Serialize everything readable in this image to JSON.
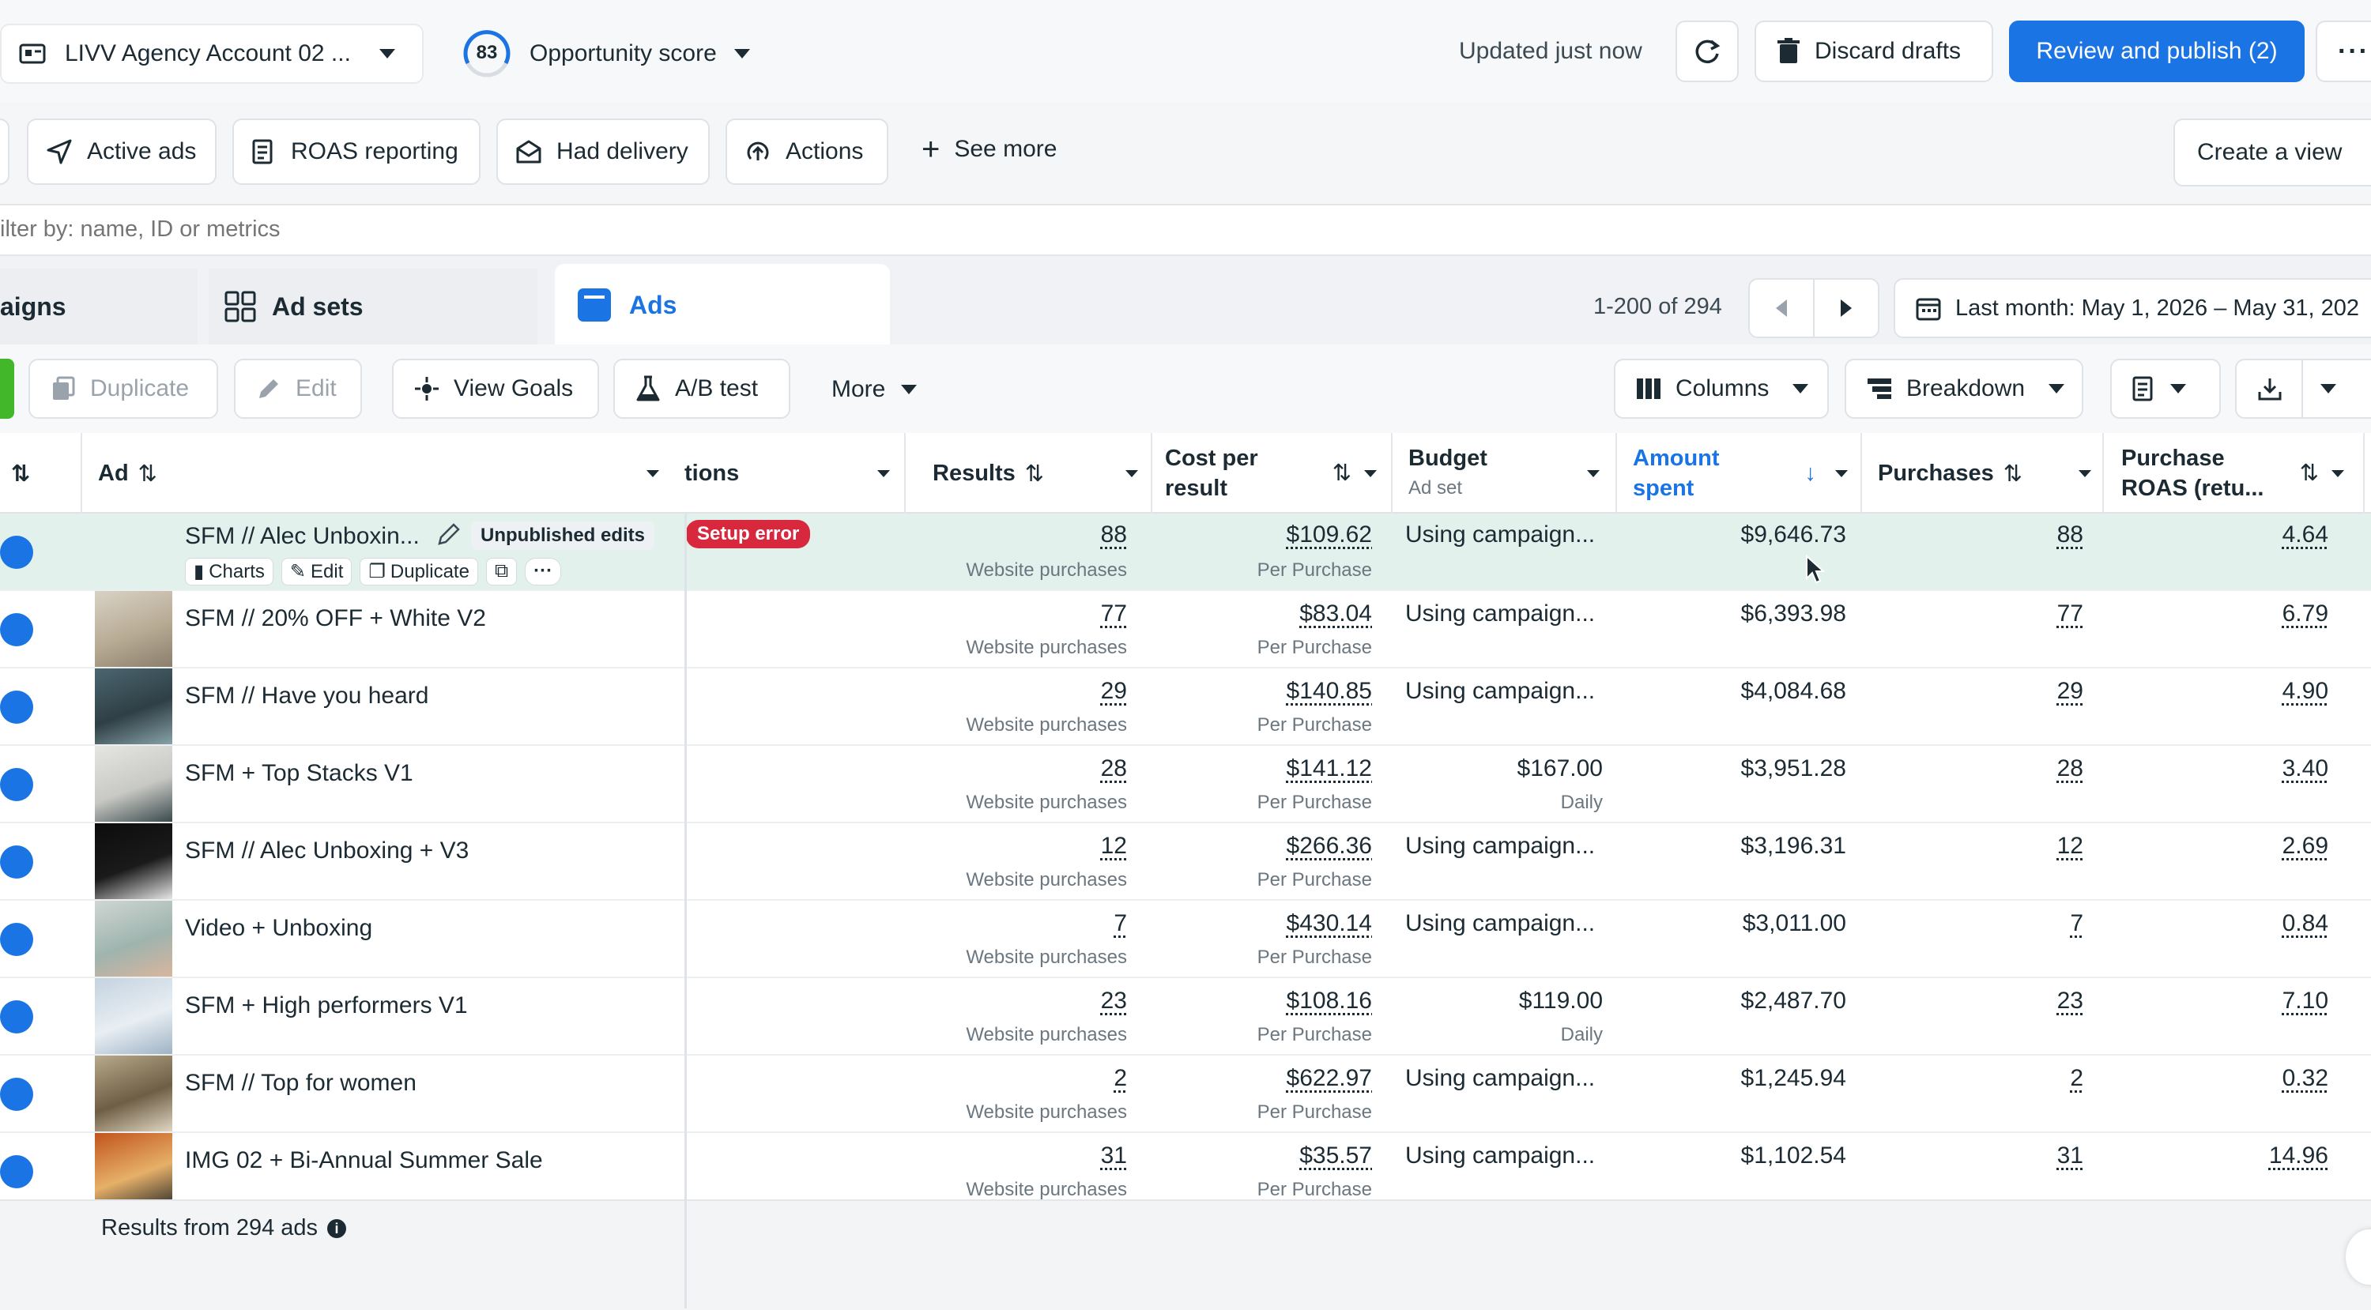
{
  "topbar": {
    "account": "LIVV Agency Account 02 ...",
    "score_value": "83",
    "score_label": "Opportunity score",
    "updated": "Updated just now",
    "discard": "Discard drafts",
    "publish": "Review and publish (2)"
  },
  "views": {
    "items": [
      "Active ads",
      "ROAS reporting",
      "Had delivery",
      "Actions"
    ],
    "see_more": "See more",
    "create_view": "Create a view"
  },
  "filter": {
    "placeholder": "ilter by: name, ID or metrics"
  },
  "tabs": {
    "campaigns": "aigns",
    "adsets": "Ad sets",
    "ads": "Ads",
    "pagination": "1-200 of 294",
    "date_range": "Last month: May 1, 2026 – May 31, 202"
  },
  "toolbar": {
    "duplicate": "Duplicate",
    "edit": "Edit",
    "view_goals": "View Goals",
    "ab_test": "A/B test",
    "more": "More",
    "columns": "Columns",
    "breakdown": "Breakdown"
  },
  "table": {
    "headers": {
      "ad": "Ad",
      "actions": "tions",
      "results": "Results",
      "cpr_1": "Cost per",
      "cpr_2": "result",
      "budget": "Budget",
      "budget_sub": "Ad set",
      "amount_1": "Amount",
      "amount_2": "spent",
      "purchases": "Purchases",
      "roas_1": "Purchase",
      "roas_2": "ROAS (retu..."
    },
    "first_row_extras": {
      "unpublished": "Unpublished edits",
      "setup_error": "Setup error",
      "charts": "Charts",
      "edit": "Edit",
      "duplicate": "Duplicate"
    },
    "rows": [
      {
        "name": "SFM // Alec Unboxin...",
        "results": "88",
        "results_sub": "Website purchases",
        "cpr": "$109.62",
        "cpr_sub": "Per Purchase",
        "budget": "Using campaign...",
        "budget_sub": "",
        "amount": "$9,646.73",
        "purchases": "88",
        "roas": "4.64"
      },
      {
        "name": "SFM // 20% OFF + White V2",
        "results": "77",
        "results_sub": "Website purchases",
        "cpr": "$83.04",
        "cpr_sub": "Per Purchase",
        "budget": "Using campaign...",
        "budget_sub": "",
        "amount": "$6,393.98",
        "purchases": "77",
        "roas": "6.79"
      },
      {
        "name": "SFM // Have you heard",
        "results": "29",
        "results_sub": "Website purchases",
        "cpr": "$140.85",
        "cpr_sub": "Per Purchase",
        "budget": "Using campaign...",
        "budget_sub": "",
        "amount": "$4,084.68",
        "purchases": "29",
        "roas": "4.90"
      },
      {
        "name": "SFM + Top Stacks V1",
        "results": "28",
        "results_sub": "Website purchases",
        "cpr": "$141.12",
        "cpr_sub": "Per Purchase",
        "budget": "$167.00",
        "budget_sub": "Daily",
        "amount": "$3,951.28",
        "purchases": "28",
        "roas": "3.40"
      },
      {
        "name": "SFM // Alec Unboxing + V3",
        "results": "12",
        "results_sub": "Website purchases",
        "cpr": "$266.36",
        "cpr_sub": "Per Purchase",
        "budget": "Using campaign...",
        "budget_sub": "",
        "amount": "$3,196.31",
        "purchases": "12",
        "roas": "2.69"
      },
      {
        "name": "Video + Unboxing",
        "results": "7",
        "results_sub": "Website purchases",
        "cpr": "$430.14",
        "cpr_sub": "Per Purchase",
        "budget": "Using campaign...",
        "budget_sub": "",
        "amount": "$3,011.00",
        "purchases": "7",
        "roas": "0.84"
      },
      {
        "name": "SFM + High performers V1",
        "results": "23",
        "results_sub": "Website purchases",
        "cpr": "$108.16",
        "cpr_sub": "Per Purchase",
        "budget": "$119.00",
        "budget_sub": "Daily",
        "amount": "$2,487.70",
        "purchases": "23",
        "roas": "7.10"
      },
      {
        "name": "SFM // Top for women",
        "results": "2",
        "results_sub": "Website purchases",
        "cpr": "$622.97",
        "cpr_sub": "Per Purchase",
        "budget": "Using campaign...",
        "budget_sub": "",
        "amount": "$1,245.94",
        "purchases": "2",
        "roas": "0.32"
      },
      {
        "name": "IMG 02 + Bi-Annual Summer Sale",
        "results": "31",
        "results_sub": "Website purchases",
        "cpr": "$35.57",
        "cpr_sub": "Per Purchase",
        "budget": "Using campaign...",
        "budget_sub": "",
        "amount": "$1,102.54",
        "purchases": "31",
        "roas": "14.96"
      }
    ]
  },
  "footer": {
    "text": "Results from 294 ads"
  },
  "colors": {
    "primary": "#1b74e4",
    "highlight": "#e3f1ed",
    "error": "#e41e3f"
  }
}
